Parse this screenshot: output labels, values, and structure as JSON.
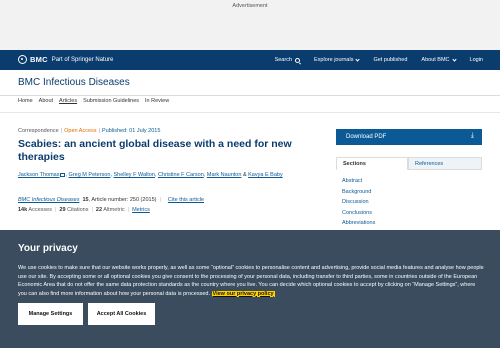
{
  "ad": {
    "label": "Advertisement"
  },
  "topbar": {
    "brand": "BMC",
    "brand_sub": "Part of Springer Nature",
    "nav": [
      "Search",
      "Explore journals",
      "Get published",
      "About BMC",
      "Login"
    ]
  },
  "journal": {
    "title": "BMC Infectious Diseases"
  },
  "subnav": [
    "Home",
    "About",
    "Articles",
    "Submission Guidelines",
    "In Review"
  ],
  "article": {
    "type": "Correspondence",
    "access": "Open Access",
    "published": "Published: 01 July 2015",
    "title": "Scabies: an ancient global disease with a need for new therapies",
    "authors": [
      "Jackson Thomas",
      "Greg M Peterson",
      "Shelley F Walton",
      "Christine F Carson",
      "Mark Naunton",
      "Kavya E Baby"
    ],
    "author_amp": "&",
    "citation": {
      "journal": "BMC Infectious Diseases",
      "volume": "15",
      "article_number": "Article number: 250 (2015)",
      "cite_link": "Cite this article"
    },
    "metrics": {
      "accesses_value": "14k",
      "accesses_label": "Accesses",
      "citations_value": "29",
      "citations_label": "Citations",
      "altmetric_value": "22",
      "altmetric_label": "Altmetric",
      "metrics_link": "Metrics"
    }
  },
  "sidebar": {
    "download": "Download PDF",
    "tabs": [
      "Sections",
      "References"
    ],
    "sections": [
      "Abstract",
      "Background",
      "Discussion",
      "Conclusions",
      "Abbreviations"
    ]
  },
  "privacy": {
    "title": "Your privacy",
    "text": "We use cookies to make sure that our website works properly, as well as some “optional” cookies to personalise content and advertising, provide social media features and analyse how people use our site. By accepting some or all optional cookies you give consent to the processing of your personal data, including transfer to third parties, some in countries outside of the European Economic Area that do not offer the same data protection standards as the country where you live. You can decide which optional cookies to accept by clicking on “Manage Settings”, where you can also find more information about how your personal data is processed.",
    "policy_link": "View our privacy policy",
    "manage_button": "Manage Settings",
    "accept_button": "Accept All Cookies"
  },
  "colors": {
    "brand": "#0b3c6e",
    "link": "#0b5a96",
    "overlay": "#3a4c5e",
    "highlight": "#ffd200",
    "open_access": "#e07000"
  }
}
